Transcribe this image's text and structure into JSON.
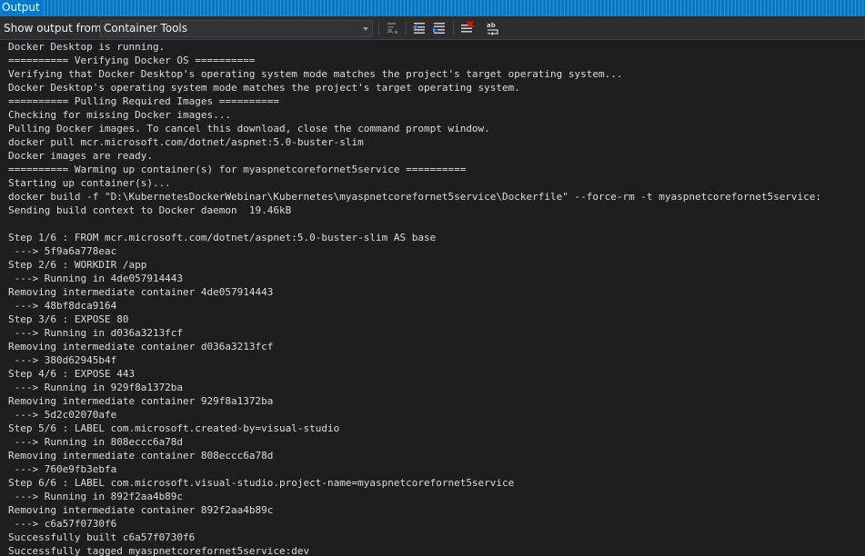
{
  "window": {
    "title": "Output"
  },
  "toolbar": {
    "show_output_label": "Show output from:",
    "source_value": "Container Tools",
    "icons": [
      "find-message-icon",
      "go-to-previous-icon",
      "go-to-next-icon",
      "clear-all-icon",
      "toggle-word-wrap-icon"
    ]
  },
  "output": {
    "lines": [
      "Docker Desktop is running.",
      "========== Verifying Docker OS ==========",
      "Verifying that Docker Desktop's operating system mode matches the project's target operating system...",
      "Docker Desktop's operating system mode matches the project's target operating system.",
      "========== Pulling Required Images ==========",
      "Checking for missing Docker images...",
      "Pulling Docker images. To cancel this download, close the command prompt window.",
      "docker pull mcr.microsoft.com/dotnet/aspnet:5.0-buster-slim",
      "Docker images are ready.",
      "========== Warming up container(s) for myaspnetcorefornet5service ==========",
      "Starting up container(s)...",
      "docker build -f \"D:\\KubernetesDockerWebinar\\Kubernetes\\myaspnetcorefornet5service\\Dockerfile\" --force-rm -t myaspnetcorefornet5service:",
      "Sending build context to Docker daemon  19.46kB",
      "",
      "Step 1/6 : FROM mcr.microsoft.com/dotnet/aspnet:5.0-buster-slim AS base",
      " ---> 5f9a6a778eac",
      "Step 2/6 : WORKDIR /app",
      " ---> Running in 4de057914443",
      "Removing intermediate container 4de057914443",
      " ---> 48bf8dca9164",
      "Step 3/6 : EXPOSE 80",
      " ---> Running in d036a3213fcf",
      "Removing intermediate container d036a3213fcf",
      " ---> 380d62945b4f",
      "Step 4/6 : EXPOSE 443",
      " ---> Running in 929f8a1372ba",
      "Removing intermediate container 929f8a1372ba",
      " ---> 5d2c02070afe",
      "Step 5/6 : LABEL com.microsoft.created-by=visual-studio",
      " ---> Running in 808eccc6a78d",
      "Removing intermediate container 808eccc6a78d",
      " ---> 760e9fb3ebfa",
      "Step 6/6 : LABEL com.microsoft.visual-studio.project-name=myaspnetcorefornet5service",
      " ---> Running in 892f2aa4b89c",
      "Removing intermediate container 892f2aa4b89c",
      " ---> c6a57f0730f6",
      "Successfully built c6a57f0730f6",
      "Successfully tagged myaspnetcorefornet5service:dev"
    ]
  },
  "colors": {
    "accent": "#007acc",
    "background": "#1e1e1e",
    "toolbar": "#2d2d30",
    "text": "#dcdcdc"
  }
}
